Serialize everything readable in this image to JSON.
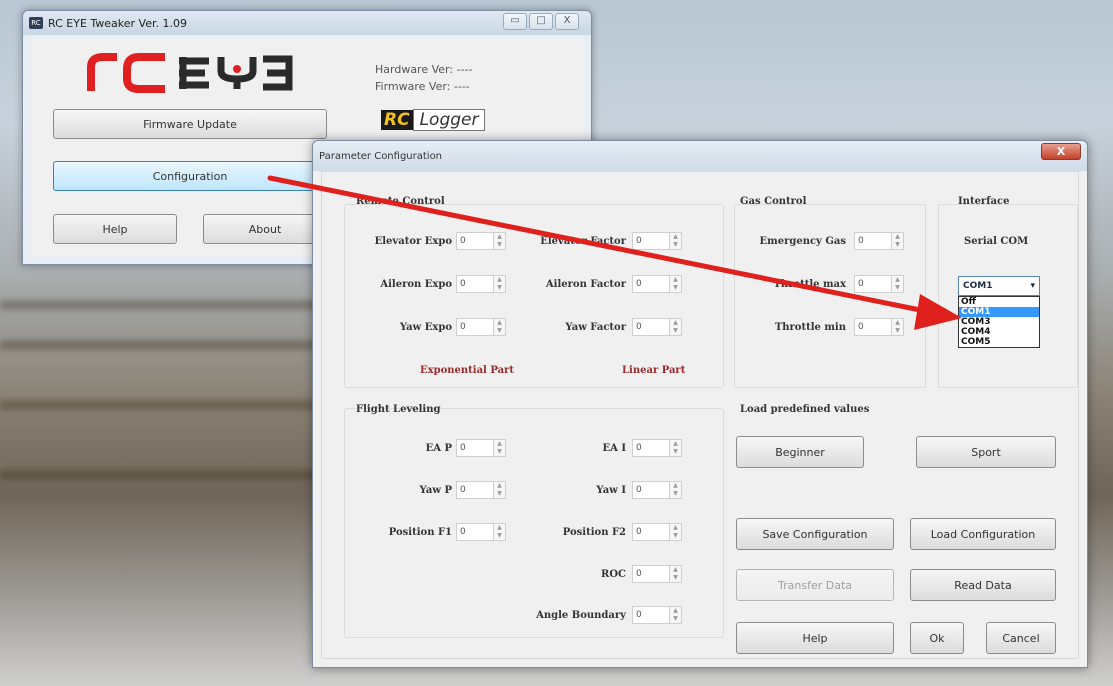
{
  "main_window": {
    "title": "RC EYE Tweaker Ver. 1.09",
    "caption_buttons": [
      "▭",
      "□",
      "X"
    ],
    "logo_text": "rceye",
    "hardware_label": "Hardware Ver:  ----",
    "firmware_label": "Firmware Ver:  ----",
    "rclogger_rc": "RC",
    "rclogger_logger": "Logger",
    "buttons": {
      "firmware_update": "Firmware Update",
      "configuration": "Configuration",
      "help": "Help",
      "about": "About"
    }
  },
  "param_dialog": {
    "title": "Parameter Configuration",
    "close": "X",
    "remote_control": {
      "label": "Remote Control",
      "fields": [
        {
          "label": "Elevator Expo",
          "value": "0"
        },
        {
          "label": "Aileron Expo",
          "value": "0"
        },
        {
          "label": "Yaw Expo",
          "value": "0"
        },
        {
          "label": "Elevator Factor",
          "value": "0"
        },
        {
          "label": "Aileron Factor",
          "value": "0"
        },
        {
          "label": "Yaw Factor",
          "value": "0"
        }
      ],
      "exponential_part": "Exponential Part",
      "linear_part": "Linear Part"
    },
    "gas_control": {
      "label": "Gas Control",
      "fields": [
        {
          "label": "Emergency Gas",
          "value": "0"
        },
        {
          "label": "Throttle max",
          "value": "0"
        },
        {
          "label": "Throttle min",
          "value": "0"
        }
      ]
    },
    "interface": {
      "label": "Interface",
      "serial_label": "Serial COM",
      "selected": "COM1",
      "options": [
        "Off",
        "COM1",
        "COM3",
        "COM4",
        "COM5"
      ]
    },
    "flight_leveling": {
      "label": "Flight Leveling",
      "fields": [
        {
          "label": "EA P",
          "value": "0"
        },
        {
          "label": "Yaw P",
          "value": "0"
        },
        {
          "label": "Position F1",
          "value": "0"
        },
        {
          "label": "EA I",
          "value": "0"
        },
        {
          "label": "Yaw I",
          "value": "0"
        },
        {
          "label": "Position F2",
          "value": "0"
        },
        {
          "label": "ROC",
          "value": "0"
        },
        {
          "label": "Angle Boundary",
          "value": "0"
        }
      ]
    },
    "predefined": {
      "label": "Load predefined values",
      "beginner": "Beginner",
      "sport": "Sport"
    },
    "buttons": {
      "save": "Save Configuration",
      "load": "Load Configuration",
      "transfer": "Transfer Data",
      "read": "Read Data",
      "help": "Help",
      "ok": "Ok",
      "cancel": "Cancel"
    }
  },
  "colors": {
    "arrow": "#e0201c",
    "highlight": "#3399ff",
    "logo_red": "#e02020",
    "logo_dark": "#2a2a2a"
  }
}
